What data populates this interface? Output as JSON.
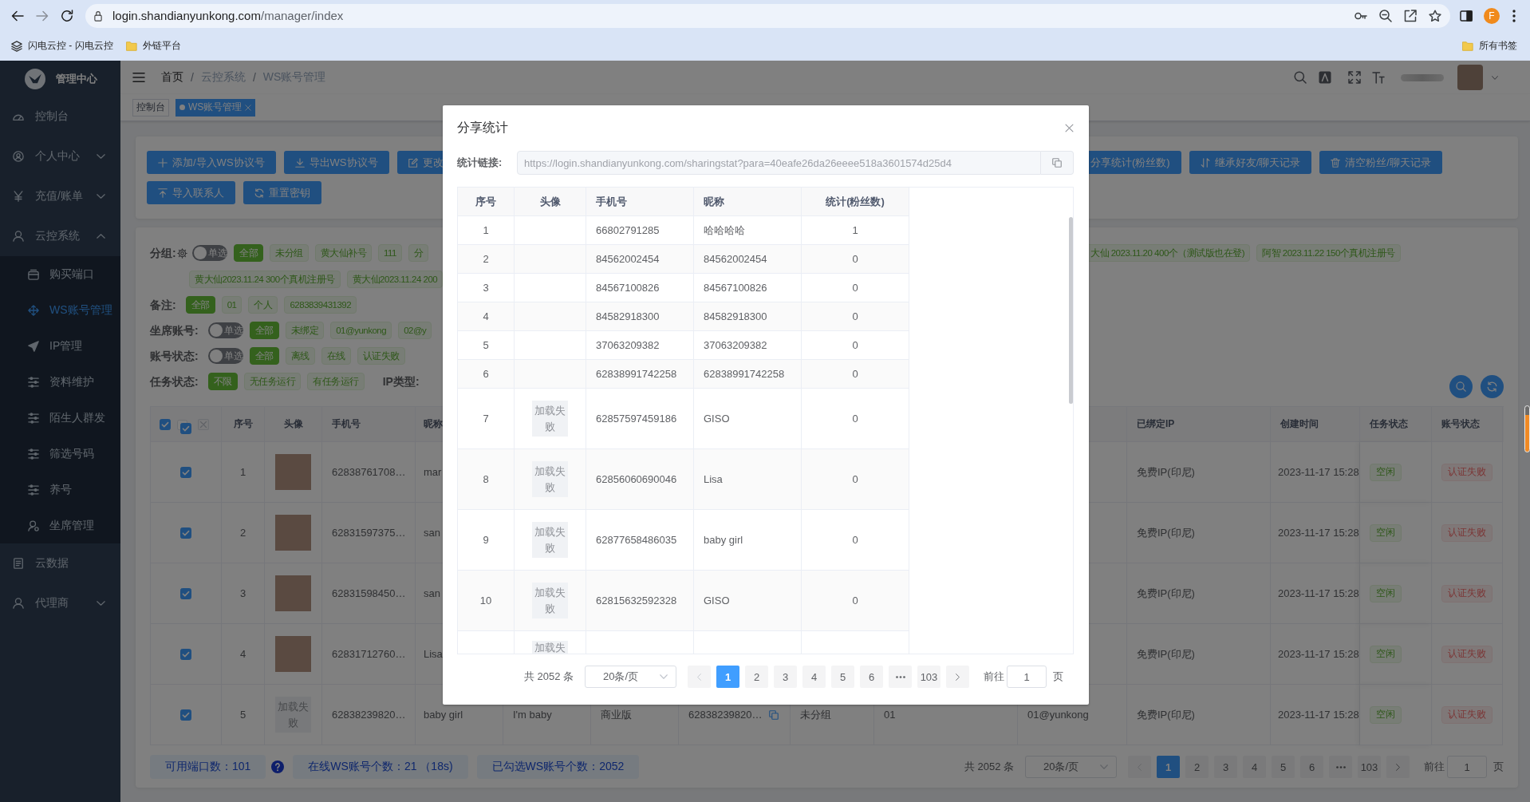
{
  "browser": {
    "url_host": "login.shandianyunkong.com",
    "url_path": "/manager/index",
    "profile_initial": "F",
    "bookmarks": [
      {
        "kind": "site",
        "label": "闪电云控 - 闪电云控"
      },
      {
        "kind": "folder",
        "label": "外链平台"
      }
    ],
    "all_bookmarks": "所有书签"
  },
  "sidebar": {
    "title": "管理中心",
    "items": [
      {
        "kind": "link",
        "label": "控制台",
        "selected": false
      },
      {
        "kind": "group",
        "label": "个人中心",
        "selected": false,
        "expanded": false
      },
      {
        "kind": "group",
        "label": "充值/账单",
        "selected": false,
        "expanded": false
      },
      {
        "kind": "group",
        "label": "云控系统",
        "selected": false,
        "expanded": true,
        "children": [
          {
            "label": "购买端口",
            "selected": false
          },
          {
            "label": "WS账号管理",
            "selected": true
          },
          {
            "label": "IP管理",
            "selected": false
          },
          {
            "label": "资料维护",
            "selected": false
          },
          {
            "label": "陌生人群发",
            "selected": false
          },
          {
            "label": "筛选号码",
            "selected": false
          },
          {
            "label": "养号",
            "selected": false
          },
          {
            "label": "坐席管理",
            "selected": false
          }
        ]
      },
      {
        "kind": "link",
        "label": "云数据",
        "selected": false
      },
      {
        "kind": "group",
        "label": "代理商",
        "selected": false,
        "expanded": false
      }
    ]
  },
  "header": {
    "breadcrumb": {
      "separator": "/",
      "items": [
        {
          "label": "首页",
          "link": true
        },
        {
          "label": "云控系统",
          "link": false
        },
        {
          "label": "WS账号管理",
          "link": false
        }
      ]
    }
  },
  "tabs": [
    {
      "label": "控制台",
      "selected": false,
      "closable": false
    },
    {
      "label": "WS账号管理",
      "selected": true,
      "closable": true
    }
  ],
  "toolbar": {
    "rows": [
      [
        "添加/导入WS协议号",
        "导出WS协议号",
        "更改",
        "分享统计(粉丝数)",
        "继承好友/聊天记录",
        "清空粉丝/聊天记录"
      ],
      [
        "导入联系人",
        "重置密钥"
      ]
    ]
  },
  "filters": [
    {
      "label": "分组:",
      "toggle": {
        "label": "单选",
        "on": false
      },
      "tag_lines": [
        [
          {
            "label": "全部",
            "selected": true
          },
          {
            "label": "未分组",
            "selected": false
          },
          {
            "label": "黄大仙补号",
            "selected": false
          },
          {
            "label": "111",
            "selected": false
          },
          {
            "label": "分",
            "selected": false
          },
          {
            "label": "大仙 2023.11.20 400个（测试版也在登)",
            "selected": false
          },
          {
            "label": "阿智 2023.11.22 150个真机注册号",
            "selected": false
          }
        ],
        [
          {
            "label": "黄大仙2023.11.24 300个真机注册号",
            "selected": false
          },
          {
            "label": "黄大仙2023.11.24 200",
            "selected": false
          }
        ]
      ]
    },
    {
      "label": "备注:",
      "tag_lines": [
        [
          {
            "label": "全部",
            "selected": true
          },
          {
            "label": "01",
            "selected": false
          },
          {
            "label": "个人",
            "selected": false
          },
          {
            "label": "6283839431392",
            "selected": false
          }
        ]
      ]
    },
    {
      "label": "坐席账号:",
      "toggle": {
        "label": "单选",
        "on": false
      },
      "tag_lines": [
        [
          {
            "label": "全部",
            "selected": true
          },
          {
            "label": "未绑定",
            "selected": false
          },
          {
            "label": "01@yunkong",
            "selected": false
          },
          {
            "label": "02@y",
            "selected": false
          }
        ]
      ]
    },
    {
      "label": "账号状态:",
      "toggle": {
        "label": "单选",
        "on": false
      },
      "tag_lines": [
        [
          {
            "label": "全部",
            "selected": true
          },
          {
            "label": "离线",
            "selected": false
          },
          {
            "label": "在线",
            "selected": false
          },
          {
            "label": "认证失败",
            "selected": false
          }
        ]
      ]
    },
    {
      "label": "任务状态:",
      "tag_lines": [
        [
          {
            "label": "不限",
            "selected": true
          },
          {
            "label": "无任务运行",
            "selected": false
          },
          {
            "label": "有任务运行",
            "selected": false
          }
        ]
      ],
      "secondary_label": "IP类型:"
    }
  ],
  "accounts": {
    "select_all": {
      "checked": true
    },
    "select_page": {
      "checked": true
    },
    "columns": [
      "序号",
      "头像",
      "手机号",
      "昵称",
      "已绑定IP",
      "创建时间",
      "任务状态",
      "账号状态"
    ],
    "rows": [
      {
        "selected": true,
        "seq": "1",
        "avatar": {
          "kind": "photo"
        },
        "phone": "62838761708…",
        "nickname": "mar",
        "bound_ip": "免费IP(印尼)",
        "created": "2023-11-17 15:28",
        "task_status": "空闲",
        "account_status": "认证失败"
      },
      {
        "selected": true,
        "seq": "2",
        "avatar": {
          "kind": "photo"
        },
        "phone": "62831597375…",
        "nickname": "san",
        "bound_ip": "免费IP(印尼)",
        "created": "2023-11-17 15:28",
        "task_status": "空闲",
        "account_status": "认证失败"
      },
      {
        "selected": true,
        "seq": "3",
        "avatar": {
          "kind": "photo"
        },
        "phone": "62831598450…",
        "nickname": "san",
        "bound_ip": "免费IP(印尼)",
        "created": "2023-11-17 15:28",
        "task_status": "空闲",
        "account_status": "认证失败"
      },
      {
        "selected": true,
        "seq": "4",
        "avatar": {
          "kind": "photo"
        },
        "phone": "62831712760…",
        "nickname": "Lisa",
        "bound_ip": "免费IP(印尼)",
        "created": "2023-11-17 15:28",
        "task_status": "空闲",
        "account_status": "认证失败"
      },
      {
        "selected": true,
        "seq": "5",
        "avatar": {
          "kind": "failed",
          "text": "加载失败"
        },
        "phone": "62838239820…",
        "nickname": "baby girl",
        "column_6": "I'm baby",
        "column_7": "商业版",
        "column_8": "62838239820…",
        "column_9": "未分组",
        "column_10": "01",
        "column_11": "01@yunkong",
        "bound_ip": "免费IP(印尼)",
        "created": "2023-11-17 15:28",
        "task_status": "空闲",
        "account_status": "认证失败"
      }
    ]
  },
  "status_bar": {
    "stats": [
      "可用端口数：101",
      "在线WS账号个数：21 （18s)",
      "已勾选WS账号个数：2052"
    ],
    "pagination": {
      "total": "共 2052 条",
      "page_size": "20条/页",
      "prev_disabled": true,
      "next_disabled": false,
      "pages": [
        {
          "kind": "page",
          "label": "1",
          "selected": true
        },
        {
          "kind": "page",
          "label": "2",
          "selected": false
        },
        {
          "kind": "page",
          "label": "3",
          "selected": false
        },
        {
          "kind": "page",
          "label": "4",
          "selected": false
        },
        {
          "kind": "page",
          "label": "5",
          "selected": false
        },
        {
          "kind": "page",
          "label": "6",
          "selected": false
        },
        {
          "kind": "more",
          "selected": false
        },
        {
          "kind": "page",
          "label": "103",
          "selected": false
        }
      ],
      "goto_label": "前往",
      "goto_value": "1",
      "goto_suffix": "页"
    }
  },
  "dialog": {
    "title": "分享统计",
    "link_label": "统计链接:",
    "link_value": "https://login.shandianyunkong.com/sharingstat?para=40eafe26da26eeee518a3601574d25d4",
    "table": {
      "columns": [
        "序号",
        "头像",
        "手机号",
        "昵称",
        "统计(粉丝数)"
      ],
      "rows": [
        {
          "seq": "1",
          "phone": "66802791285",
          "nickname": "哈哈哈哈",
          "count": "1"
        },
        {
          "seq": "2",
          "phone": "84562002454",
          "nickname": "84562002454",
          "count": "0"
        },
        {
          "seq": "3",
          "phone": "84567100826",
          "nickname": "84567100826",
          "count": "0"
        },
        {
          "seq": "4",
          "phone": "84582918300",
          "nickname": "84582918300",
          "count": "0"
        },
        {
          "seq": "5",
          "phone": "37063209382",
          "nickname": "37063209382",
          "count": "0"
        },
        {
          "seq": "6",
          "phone": "62838991742258",
          "nickname": "62838991742258",
          "count": "0"
        },
        {
          "seq": "7",
          "avatar": "加载失败",
          "phone": "62857597459186",
          "nickname": "GISO",
          "count": "0"
        },
        {
          "seq": "8",
          "avatar": "加载失败",
          "phone": "62856060690046",
          "nickname": "Lisa",
          "count": "0"
        },
        {
          "seq": "9",
          "avatar": "加载失败",
          "phone": "62877658486035",
          "nickname": "baby girl",
          "count": "0"
        },
        {
          "seq": "10",
          "avatar": "加载失败",
          "phone": "62815632592328",
          "nickname": "GISO",
          "count": "0"
        },
        {
          "avatar": "加载失"
        }
      ]
    },
    "pagination": {
      "total": "共 2052 条",
      "page_size": "20条/页",
      "prev_disabled": true,
      "next_disabled": false,
      "pages": [
        {
          "kind": "page",
          "label": "1",
          "selected": true
        },
        {
          "kind": "page",
          "label": "2",
          "selected": false
        },
        {
          "kind": "page",
          "label": "3",
          "selected": false
        },
        {
          "kind": "page",
          "label": "4",
          "selected": false
        },
        {
          "kind": "page",
          "label": "5",
          "selected": false
        },
        {
          "kind": "page",
          "label": "6",
          "selected": false
        },
        {
          "kind": "more",
          "selected": false
        },
        {
          "kind": "page",
          "label": "103",
          "selected": false
        }
      ],
      "goto_label": "前往",
      "goto_value": "1",
      "goto_suffix": "页"
    }
  }
}
